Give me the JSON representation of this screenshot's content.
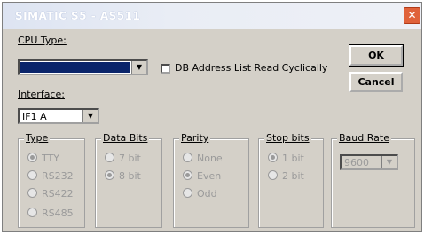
{
  "window": {
    "title": "SIMATIC S5 - AS511",
    "close_symbol": "✕"
  },
  "cpu_type": {
    "label": "CPU Type:",
    "value": "",
    "arrow": "▼"
  },
  "db_option": {
    "label": "DB Address List Read Cyclically",
    "checked": false
  },
  "interface": {
    "label": "Interface:",
    "value": "IF1 A",
    "arrow": "▼"
  },
  "buttons": {
    "ok": "OK",
    "cancel": "Cancel"
  },
  "type_group": {
    "caption": "Type",
    "options": [
      "TTY",
      "RS232",
      "RS422",
      "RS485"
    ],
    "selected": "TTY"
  },
  "data_bits_group": {
    "caption": "Data Bits",
    "options": [
      "7 bit",
      "8 bit"
    ],
    "selected": "8 bit"
  },
  "parity_group": {
    "caption": "Parity",
    "options": [
      "None",
      "Even",
      "Odd"
    ],
    "selected": "Even"
  },
  "stop_bits_group": {
    "caption": "Stop bits",
    "options": [
      "1 bit",
      "2 bit"
    ],
    "selected": "1 bit"
  },
  "baud_rate_group": {
    "caption": "Baud Rate",
    "value": "9600",
    "arrow": "▼"
  }
}
